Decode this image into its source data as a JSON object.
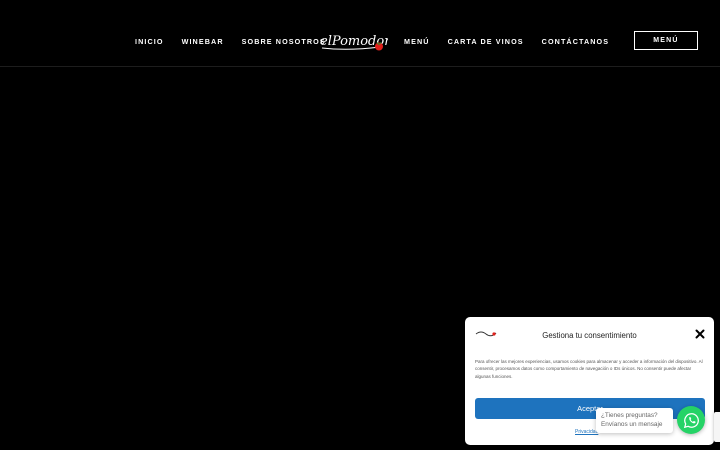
{
  "nav": {
    "left": [
      "INICIO",
      "WINEBAR",
      "SOBRE NOSOTROS"
    ],
    "right": [
      "MENÚ",
      "CARTA DE VINOS",
      "CONTÁCTANOS"
    ]
  },
  "logo": {
    "text": "elPomodoro",
    "brand_color": "#e0201b"
  },
  "menu_button": {
    "label": "MENÚ"
  },
  "consent": {
    "title": "Gestiona tu consentimiento",
    "body": "Para ofrecer las mejores experiencias, usamos cookies para almacenar y acceder a información del dispositivo. Al consentir, procesamos datos como comportamiento de navegación o IDs únicos. No consentir puede afectar algunas funciones.",
    "accept_label": "Aceptar",
    "policy_link": "Privacidad",
    "accent_color": "#1e73be"
  },
  "whatsapp": {
    "line1": "¿Tienes preguntas?",
    "line2": "Envíanos un mensaje",
    "color": "#25d366"
  },
  "icons": [
    "close-icon",
    "whatsapp-icon",
    "recaptcha-badge"
  ]
}
